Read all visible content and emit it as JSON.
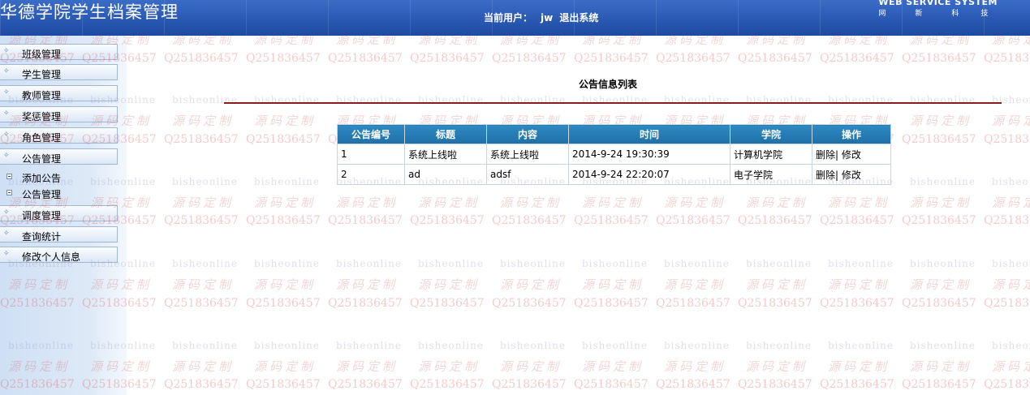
{
  "header": {
    "title": "华德学院学生档案管理",
    "user_label": "当前用户：",
    "username": "jw",
    "logout": "退出系统",
    "brand": "WEB SERVICE SYSTEM",
    "brand_sub": [
      "网",
      "新",
      "科",
      "技"
    ]
  },
  "watermark": {
    "qq": "Q2518364",
    "cn": "源码定制",
    "biz": "bisheonline"
  },
  "sidebar": {
    "items": [
      {
        "label": "班级管理",
        "type": "menu"
      },
      {
        "label": "学生管理",
        "type": "menu"
      },
      {
        "label": "教师管理",
        "type": "menu"
      },
      {
        "label": "奖惩管理",
        "type": "menu"
      },
      {
        "label": "角色管理",
        "type": "menu"
      },
      {
        "label": "公告管理",
        "type": "menu"
      },
      {
        "label": "添加公告",
        "type": "sub"
      },
      {
        "label": "公告管理",
        "type": "sub"
      },
      {
        "label": "调度管理",
        "type": "menu"
      },
      {
        "label": "查询统计",
        "type": "menu"
      },
      {
        "label": "修改个人信息",
        "type": "menu"
      }
    ]
  },
  "main": {
    "title": "公告信息列表",
    "columns": [
      "公告编号",
      "标题",
      "内容",
      "时间",
      "学院",
      "操作"
    ],
    "rows": [
      {
        "id": "1",
        "title": "系统上线啦",
        "content": "系统上线啦",
        "time": "2014-9-24 19:30:39",
        "college": "计算机学院",
        "delete": "删除|",
        "edit": "修改"
      },
      {
        "id": "2",
        "title": "ad",
        "content": "adsf",
        "time": "2014-9-24 22:20:07",
        "college": "电子学院",
        "delete": "删除|",
        "edit": "修改"
      }
    ]
  },
  "colors": {
    "header": "#2a59b4",
    "table_header": "#1f6fa6",
    "title_rule": "#8a1e1e"
  }
}
